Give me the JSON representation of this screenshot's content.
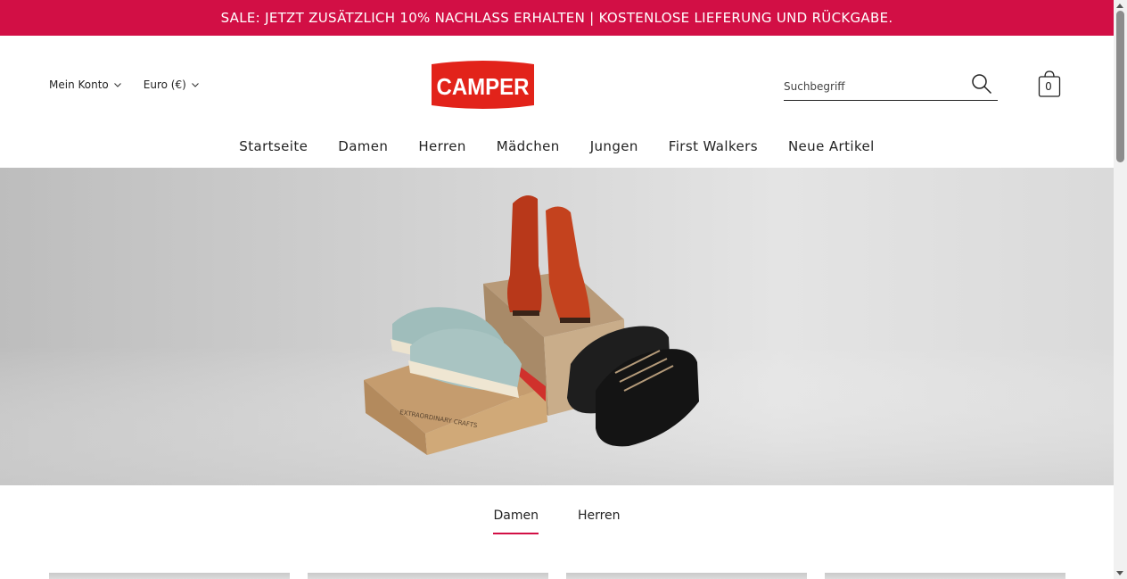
{
  "promo": {
    "text": "SALE: JETZT ZUSÄTZLICH 10% NACHLASS ERHALTEN | KOSTENLOSE LIEFERUNG UND RÜCKGABE."
  },
  "header": {
    "account_label": "Mein Konto",
    "currency_label": "Euro (€)",
    "logo_text": "CAMPER",
    "search": {
      "placeholder": "Suchbegriff",
      "value": ""
    },
    "cart_count": "0"
  },
  "nav": {
    "items": [
      {
        "label": "Startseite"
      },
      {
        "label": "Damen"
      },
      {
        "label": "Herren"
      },
      {
        "label": "Mädchen"
      },
      {
        "label": "Jungen"
      },
      {
        "label": "First Walkers"
      },
      {
        "label": "Neue Artikel"
      }
    ]
  },
  "hero": {
    "box_text": "EXTRAORDINARY CRAFTS"
  },
  "tabs": {
    "items": [
      {
        "label": "Damen",
        "active": true
      },
      {
        "label": "Herren",
        "active": false
      }
    ]
  },
  "colors": {
    "brand": "#d20f45",
    "text": "#222222",
    "background": "#ffffff"
  },
  "icons": {
    "search": "search-icon",
    "cart": "shopping-bag-icon",
    "chevron": "chevron-down-icon"
  }
}
